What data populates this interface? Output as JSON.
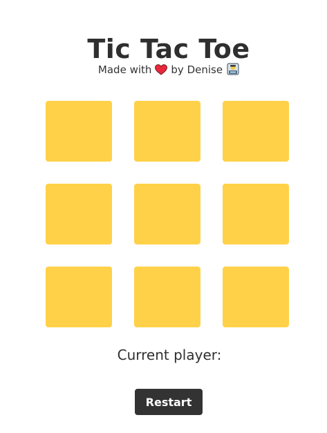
{
  "header": {
    "title": "Tic Tac Toe",
    "byline_prefix": "Made with",
    "byline_suffix": "by Denise"
  },
  "icons": {
    "heart": "heart-icon",
    "avatar": "woman-technologist-icon"
  },
  "colors": {
    "cell": "#ffd148",
    "text": "#333333",
    "button": "#333333",
    "button_text": "#ffffff",
    "heart": "#e8283a"
  },
  "board": {
    "cells": [
      "",
      "",
      "",
      "",
      "",
      "",
      "",
      "",
      ""
    ]
  },
  "status": {
    "label": "Current player:",
    "player": ""
  },
  "controls": {
    "restart_label": "Restart"
  }
}
